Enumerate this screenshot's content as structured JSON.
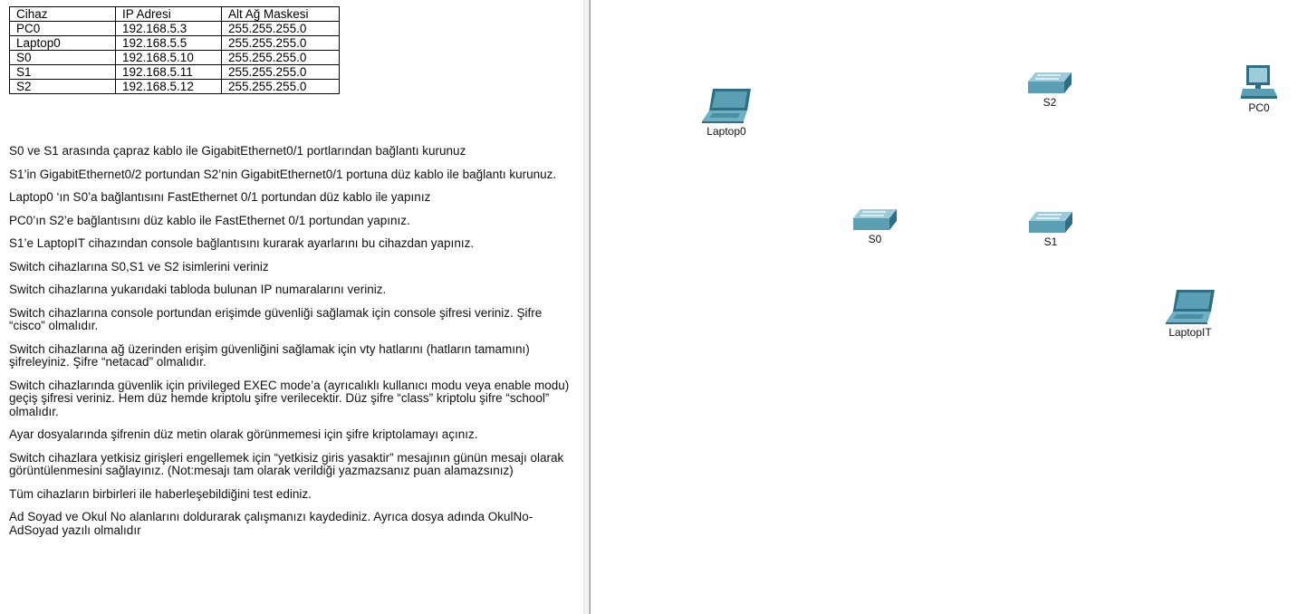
{
  "table": {
    "headers": [
      "Cihaz",
      "IP Adresi",
      "Alt Ağ Maskesi"
    ],
    "rows": [
      [
        "PC0",
        "192.168.5.3",
        "255.255.255.0"
      ],
      [
        "Laptop0",
        "192.168.5.5",
        "255.255.255.0"
      ],
      [
        "S0",
        "192.168.5.10",
        "255.255.255.0"
      ],
      [
        "S1",
        "192.168.5.11",
        "255.255.255.0"
      ],
      [
        "S2",
        "192.168.5.12",
        "255.255.255.0"
      ]
    ]
  },
  "tasks": [
    "S0 ve S1 arasında çapraz kablo ile GigabitEthernet0/1 portlarından bağlantı kurunuz",
    "S1’in GigabitEthernet0/2 portundan S2’nin GigabitEthernet0/1 portuna düz kablo ile bağlantı kurunuz.",
    "Laptop0 ‘ın S0’a bağlantısını FastEthernet 0/1 portundan düz kablo ile yapınız",
    "PC0’ın S2’e bağlantısını düz kablo ile FastEthernet 0/1 portundan yapınız.",
    "S1’e LaptopIT cihazından console bağlantısını kurarak ayarlarını bu cihazdan yapınız.",
    "Switch cihazlarına S0,S1 ve S2 isimlerini veriniz",
    "Switch cihazlarına yukarıdaki tabloda bulunan IP numaralarını veriniz.",
    "Switch cihazlarına console portundan erişimde güvenliği sağlamak için console şifresi veriniz. Şifre “cisco” olmalıdır.",
    "Switch cihazlarına ağ üzerinden erişim güvenliğini sağlamak için vty hatlarını (hatların tamamını) şifreleyiniz. Şifre “netacad” olmalıdır.",
    "Switch cihazlarında güvenlik için privileged EXEC mode’a (ayrıcalıklı kullanıcı modu veya enable modu) geçiş şifresi veriniz. Hem düz hemde kriptolu şifre verilecektir. Düz şifre “class” kriptolu şifre “school” olmalıdır.",
    "Ayar dosyalarında şifrenin düz metin olarak görünmemesi için şifre kriptolamayı açınız.",
    "Switch cihazlara yetkisiz girişleri engellemek için “yetkisiz giris yasaktir” mesajının günün mesajı olarak görüntülenmesini sağlayınız. (Not:mesajı tam olarak verildiği yazmazsanız puan alamazsınız)",
    "Tüm cihazların birbirleri ile haberleşebildiğini test ediniz.",
    "Ad Soyad ve Okul No alanlarını doldurarak çalışmanızı kaydediniz. Ayrıca dosya adında OkulNo-AdSoyad yazılı olmalıdır"
  ],
  "devices": {
    "laptop0": {
      "label": "Laptop0",
      "icon": "laptop-icon"
    },
    "s2": {
      "label": "S2",
      "icon": "switch-icon"
    },
    "pc0": {
      "label": "PC0",
      "icon": "pc-icon"
    },
    "s0": {
      "label": "S0",
      "icon": "switch-icon"
    },
    "s1": {
      "label": "S1",
      "icon": "switch-icon"
    },
    "laptopit": {
      "label": "LaptopIT",
      "icon": "laptop-icon"
    }
  },
  "colors": {
    "device_teal": "#5b9fb5",
    "device_dark": "#2f6f86",
    "device_light": "#9ccbd9"
  }
}
